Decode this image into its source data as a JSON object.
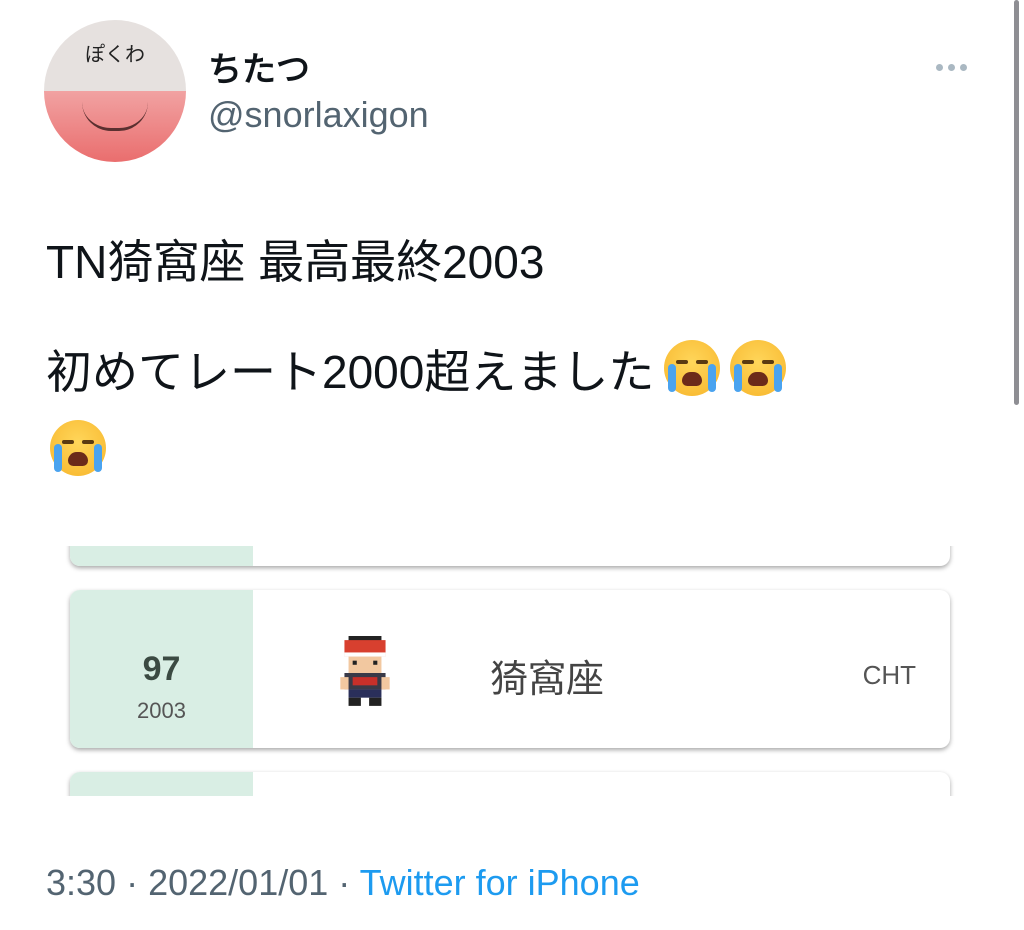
{
  "user": {
    "display_name": "ちたつ",
    "handle": "@snorlaxigon",
    "avatar_text": "ぽくわ"
  },
  "tweet": {
    "line1": "TN猗窩座  最高最終2003",
    "line2": "初めてレート2000超えました",
    "emoji_count": 3,
    "emoji_name": "loudly-crying-face"
  },
  "ranking_card": {
    "rank": "97",
    "rating": "2003",
    "player_name": "猗窩座",
    "region": "CHT",
    "side_color": "#d9eee4"
  },
  "meta": {
    "time": "3:30",
    "separator": " · ",
    "date": "2022/01/01",
    "source": "Twitter for iPhone",
    "source_color": "#1d9bf0"
  },
  "icons": {
    "more": "more-horizontal-icon",
    "sprite": "trainer-sprite"
  }
}
